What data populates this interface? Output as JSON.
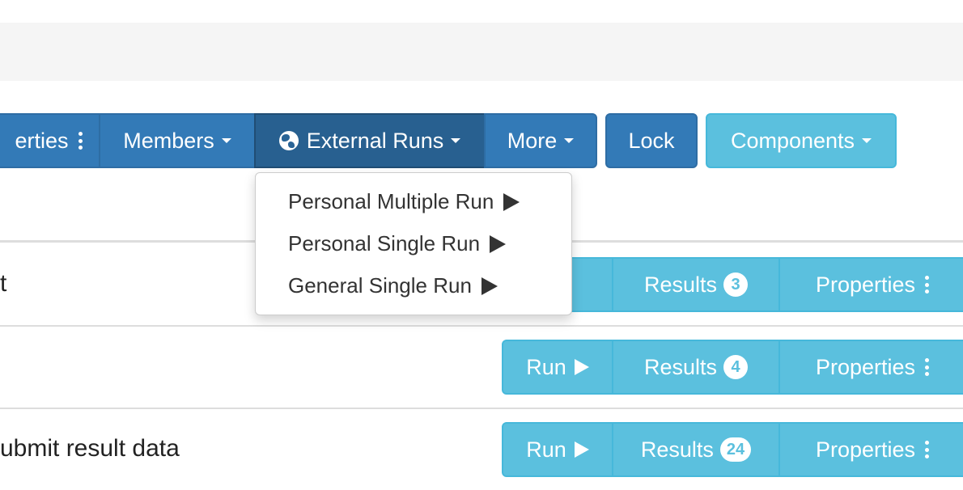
{
  "toolbar": {
    "properties_label": "erties",
    "members_label": "Members",
    "external_runs_label": "External Runs",
    "more_label": "More",
    "lock_label": "Lock",
    "components_label": "Components"
  },
  "dropdown": {
    "items": [
      {
        "label": "Personal Multiple Run"
      },
      {
        "label": "Personal Single Run"
      },
      {
        "label": "General Single Run"
      }
    ]
  },
  "rows": [
    {
      "text": "t",
      "run_label": "",
      "results_label": "Results",
      "results_count": "3",
      "properties_label": "Properties"
    },
    {
      "text": "",
      "run_label": "Run",
      "results_label": "Results",
      "results_count": "4",
      "properties_label": "Properties"
    },
    {
      "text": "ubmit result data",
      "run_label": "Run",
      "results_label": "Results",
      "results_count": "24",
      "properties_label": "Properties"
    }
  ],
  "colors": {
    "primary": "#337ab7",
    "primary_active": "#286090",
    "info": "#5bc0de",
    "toolbar_bg": "#f5f5f5"
  },
  "icons": {
    "globe": "globe-icon",
    "kebab": "vertical-dots-icon",
    "caret": "caret-down-icon",
    "play": "play-icon"
  }
}
